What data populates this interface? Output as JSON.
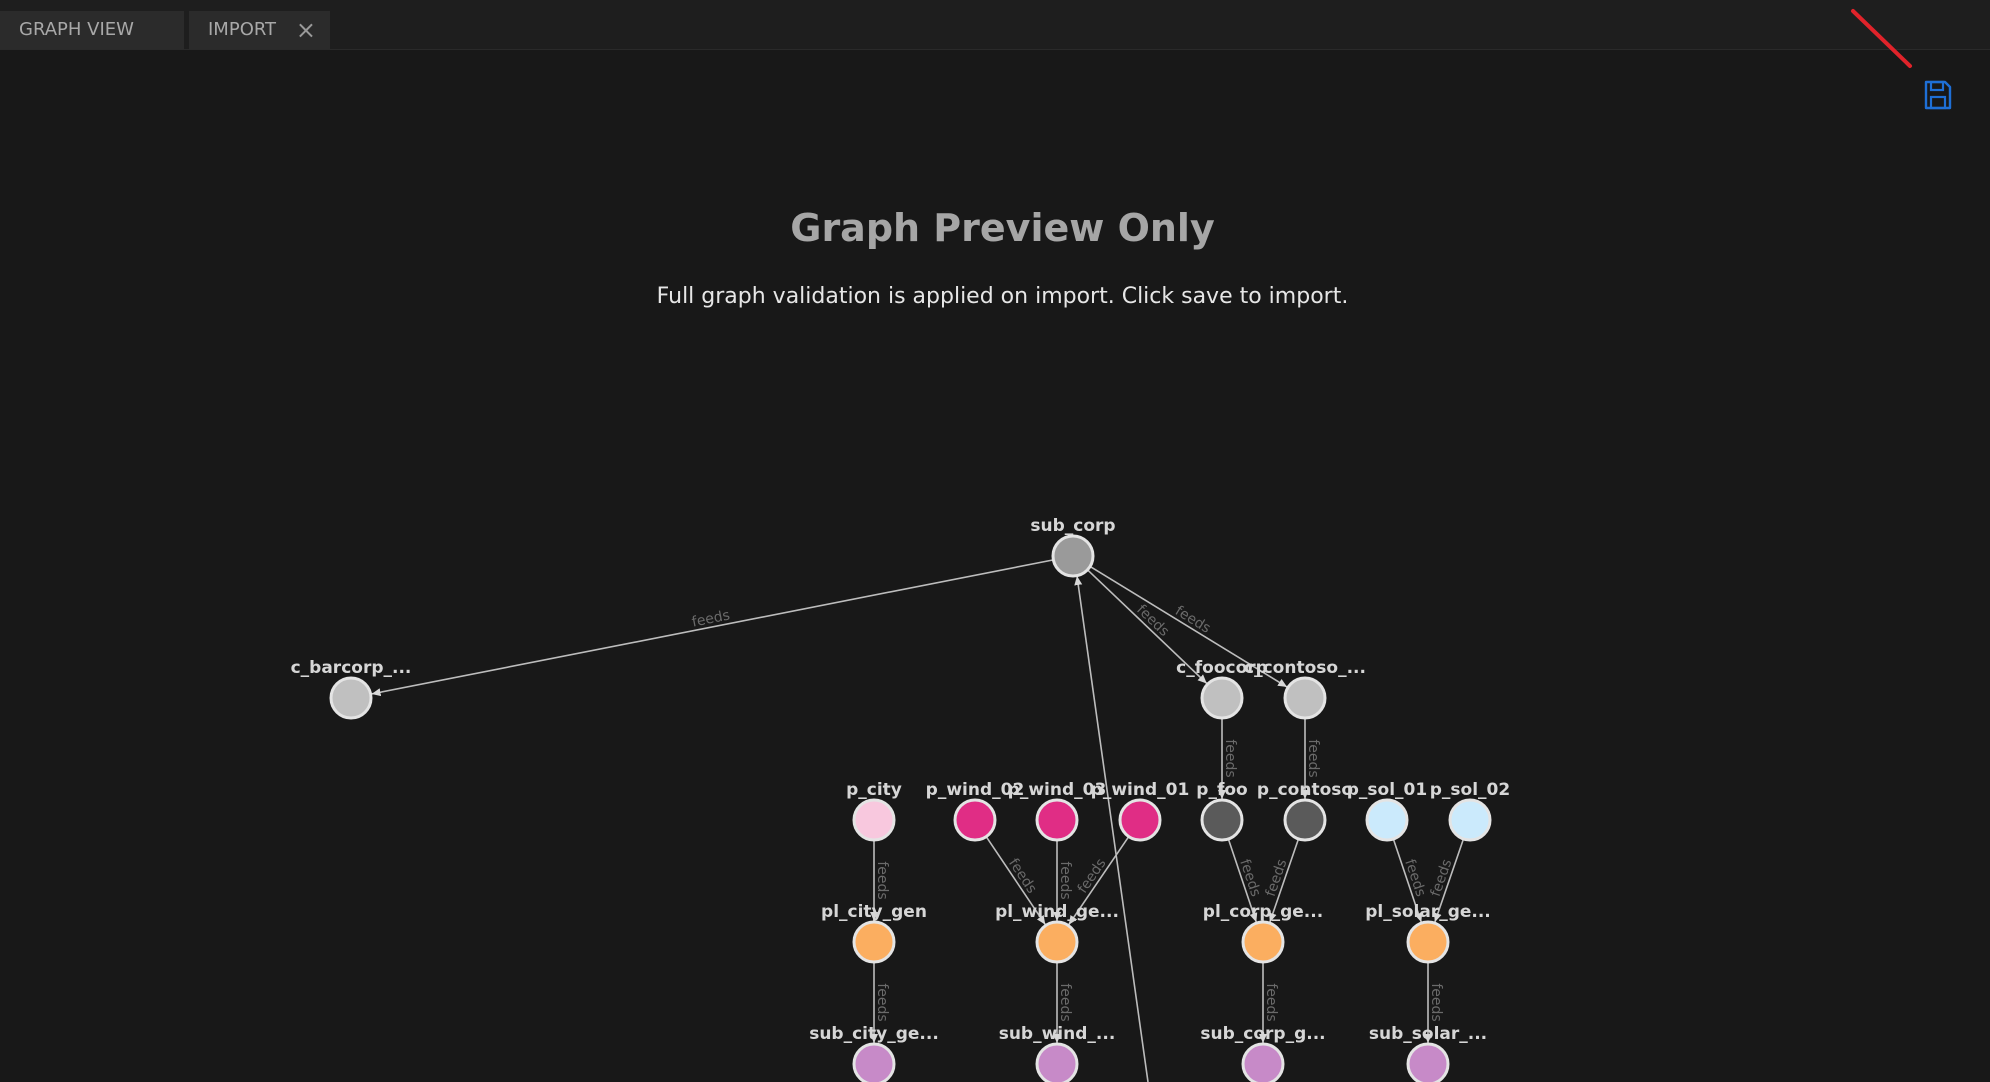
{
  "tabs": [
    {
      "label": "GRAPH VIEW"
    },
    {
      "label": "IMPORT",
      "closable": true
    }
  ],
  "toolbar": {
    "save_icon": "save-icon",
    "accent": "#1e6fd6"
  },
  "preview": {
    "title": "Graph Preview Only",
    "subtitle": "Full graph validation is applied on import. Click save to import."
  },
  "graph": {
    "colors": {
      "substation": "#9a9a9a",
      "customer": "#c0c0c0",
      "partner": "#5a5a5a",
      "city": "#f8c8de",
      "wind": "#e02d85",
      "solar": "#cbeafc",
      "plant": "#fbae60",
      "sub_gen": "#c78ac8"
    },
    "nodes": [
      {
        "id": "sub_corp",
        "label": "sub_corp",
        "type": "substation"
      },
      {
        "id": "c_barcorp",
        "label": "c_barcorp_...",
        "type": "customer"
      },
      {
        "id": "c_foocorp",
        "label": "c_foocorp",
        "type": "customer"
      },
      {
        "id": "c_contoso",
        "label": "c_contoso_...",
        "type": "customer"
      },
      {
        "id": "p_city",
        "label": "p_city",
        "type": "city"
      },
      {
        "id": "p_wind_02",
        "label": "p_wind_02",
        "type": "wind"
      },
      {
        "id": "p_wind_03",
        "label": "p_wind_03",
        "type": "wind"
      },
      {
        "id": "p_wind_01",
        "label": "p_wind_01",
        "type": "wind"
      },
      {
        "id": "p_foo",
        "label": "p_foo",
        "type": "partner"
      },
      {
        "id": "p_contoso",
        "label": "p_contoso",
        "type": "partner"
      },
      {
        "id": "p_sol_01",
        "label": "p_sol_01",
        "type": "solar"
      },
      {
        "id": "p_sol_02",
        "label": "p_sol_02",
        "type": "solar"
      },
      {
        "id": "pl_city_gen",
        "label": "pl_city_gen",
        "type": "plant"
      },
      {
        "id": "pl_wind_gen",
        "label": "pl_wind_ge...",
        "type": "plant"
      },
      {
        "id": "pl_corp_gen",
        "label": "pl_corp_ge...",
        "type": "plant"
      },
      {
        "id": "pl_solar_gen",
        "label": "pl_solar_ge...",
        "type": "plant"
      },
      {
        "id": "sub_city_gen",
        "label": "sub_city_ge...",
        "type": "sub_gen"
      },
      {
        "id": "sub_wind_gen",
        "label": "sub_wind_...",
        "type": "sub_gen"
      },
      {
        "id": "sub_corp_gen",
        "label": "sub_corp_g...",
        "type": "sub_gen"
      },
      {
        "id": "sub_solar_gen",
        "label": "sub_solar_...",
        "type": "sub_gen"
      }
    ],
    "edges": [
      {
        "from": "sub_corp",
        "to": "c_barcorp",
        "label": "feeds"
      },
      {
        "from": "sub_corp",
        "to": "c_foocorp",
        "label": "feeds"
      },
      {
        "from": "sub_corp",
        "to": "c_contoso",
        "label": "feeds"
      },
      {
        "from": "c_foocorp",
        "to": "p_foo",
        "label": "feeds"
      },
      {
        "from": "c_contoso",
        "to": "p_contoso",
        "label": "feeds"
      },
      {
        "from": "p_city",
        "to": "pl_city_gen",
        "label": "feeds"
      },
      {
        "from": "p_wind_02",
        "to": "pl_wind_gen",
        "label": "feeds"
      },
      {
        "from": "p_wind_03",
        "to": "pl_wind_gen",
        "label": "feeds"
      },
      {
        "from": "p_wind_01",
        "to": "pl_wind_gen",
        "label": "feeds"
      },
      {
        "from": "p_foo",
        "to": "pl_corp_gen",
        "label": "feeds"
      },
      {
        "from": "p_contoso",
        "to": "pl_corp_gen",
        "label": "feeds"
      },
      {
        "from": "p_sol_01",
        "to": "pl_solar_gen",
        "label": "feeds"
      },
      {
        "from": "p_sol_02",
        "to": "pl_solar_gen",
        "label": "feeds"
      },
      {
        "from": "pl_city_gen",
        "to": "sub_city_gen",
        "label": "feeds"
      },
      {
        "from": "pl_wind_gen",
        "to": "sub_wind_gen",
        "label": "feeds"
      },
      {
        "from": "pl_corp_gen",
        "to": "sub_corp_gen",
        "label": "feeds"
      },
      {
        "from": "pl_solar_gen",
        "to": "sub_solar_gen",
        "label": "feeds"
      }
    ]
  }
}
